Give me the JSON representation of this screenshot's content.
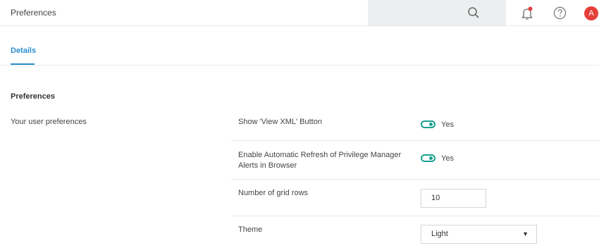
{
  "header": {
    "title": "Preferences",
    "avatar_initial": "A",
    "icons": [
      "search-icon",
      "bell-icon",
      "help-icon"
    ],
    "accent": "#2a8ed0",
    "alert_color": "#e53f3a"
  },
  "tabs": [
    {
      "label": "Details",
      "active": true
    }
  ],
  "section": {
    "title": "Preferences",
    "description": "Your user preferences"
  },
  "settings": {
    "show_xml": {
      "label": "Show 'View XML' Button",
      "value": "Yes",
      "enabled": true
    },
    "auto_refresh": {
      "label": "Enable Automatic Refresh of Privilege Manager Alerts in Browser",
      "value": "Yes",
      "enabled": true
    },
    "grid_rows": {
      "label": "Number of grid rows",
      "value": "10"
    },
    "theme": {
      "label": "Theme",
      "value": "Light"
    }
  },
  "toggle_color": "#1aa08e"
}
